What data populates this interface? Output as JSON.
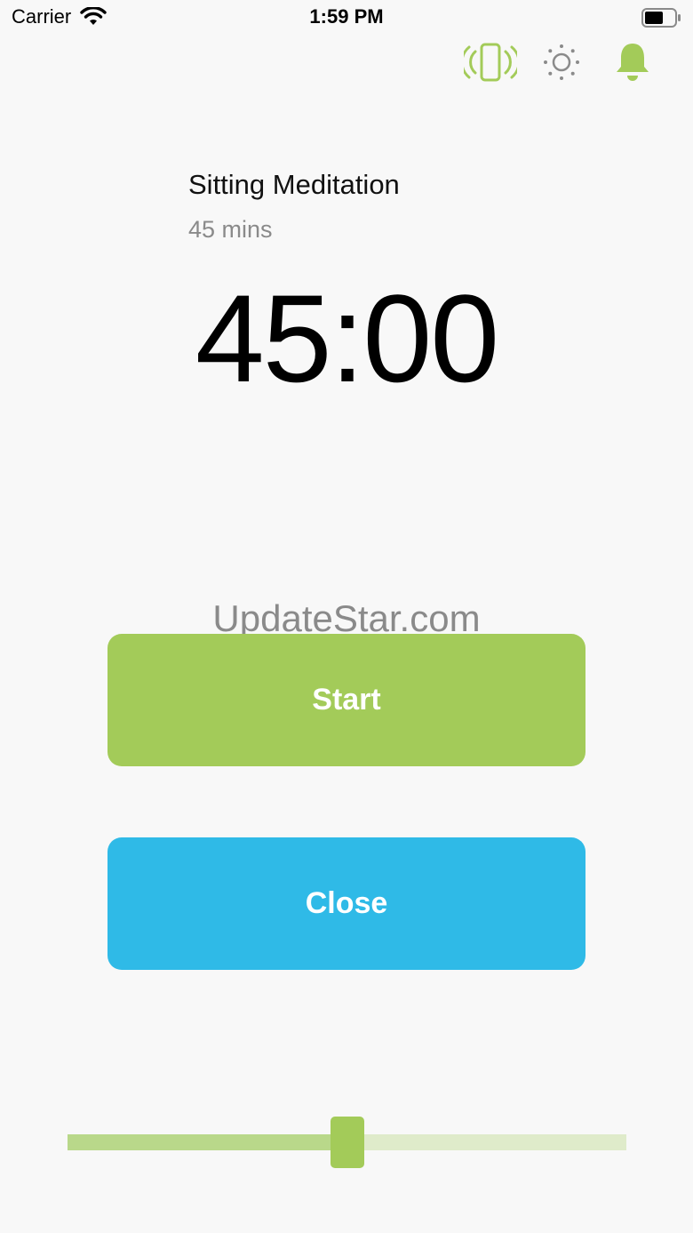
{
  "status_bar": {
    "carrier": "Carrier",
    "time": "1:59 PM"
  },
  "toolbar": {
    "icons": [
      "vibrate-icon",
      "brightness-icon",
      "bell-icon"
    ],
    "accent_color": "#a3cb59",
    "muted_color": "#8a8a8a"
  },
  "session": {
    "title": "Sitting Meditation",
    "duration_label": "45 mins",
    "countdown": "45:00"
  },
  "watermark": "UpdateStar.com",
  "actions": {
    "start_label": "Start",
    "start_color": "#a3cb59",
    "close_label": "Close",
    "close_color": "#2fbae7"
  },
  "slider": {
    "value": 0.5
  }
}
